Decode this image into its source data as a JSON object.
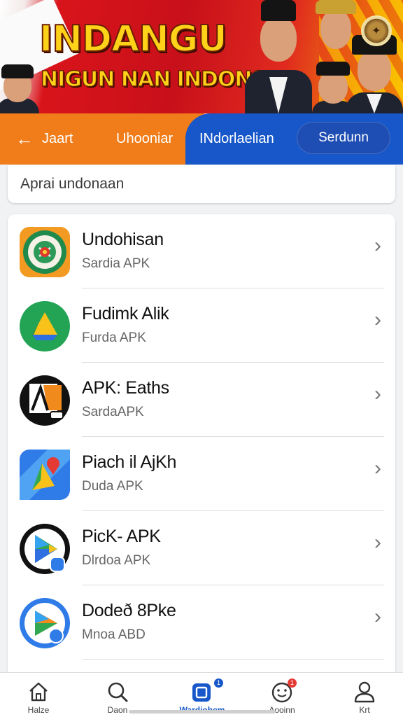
{
  "banner": {
    "title_line1": "INDANGU",
    "title_line2": "NIGUN NAN INDONSIA"
  },
  "tabs": {
    "back_label": "Jaart",
    "items": [
      "Uhooniar",
      "INdorlaelian"
    ],
    "pill_label": "Serdunn"
  },
  "search": {
    "placeholder": "Aprai undonaan"
  },
  "apps": [
    {
      "name": "Undohisan",
      "sub": "Sardia APK",
      "icon": "emblem-badge-icon"
    },
    {
      "name": "Fudimk Alik",
      "sub": "Furda APK",
      "icon": "drive-triangle-icon"
    },
    {
      "name": "APK: Eaths",
      "sub": "SardaAPK",
      "icon": "apk-logo-icon"
    },
    {
      "name": "Piach il AjKh",
      "sub": "Duda APK",
      "icon": "maps-pin-icon"
    },
    {
      "name": "PicK- APK",
      "sub": "Dlrdoa APK",
      "icon": "play-store-icon"
    },
    {
      "name": "Dodeð 8Pke",
      "sub": "Mnoa ABD",
      "icon": "play-store-badge-icon"
    }
  ],
  "bottom_nav": [
    {
      "label": "Halze",
      "icon": "home-icon",
      "active": false
    },
    {
      "label": "Daon",
      "icon": "search-icon",
      "active": false
    },
    {
      "label": "Wardiohem",
      "icon": "apps-icon",
      "active": true,
      "badge": "1"
    },
    {
      "label": "Aooinn",
      "icon": "notifications-face-icon",
      "active": false,
      "badge": "1"
    },
    {
      "label": "Krt",
      "icon": "profile-icon",
      "active": false
    }
  ],
  "colors": {
    "banner_red": "#c8101a",
    "banner_gold": "#ffd21a",
    "tab_orange": "#f07d1a",
    "tab_blue": "#1757c9",
    "badge_red": "#e53935"
  }
}
